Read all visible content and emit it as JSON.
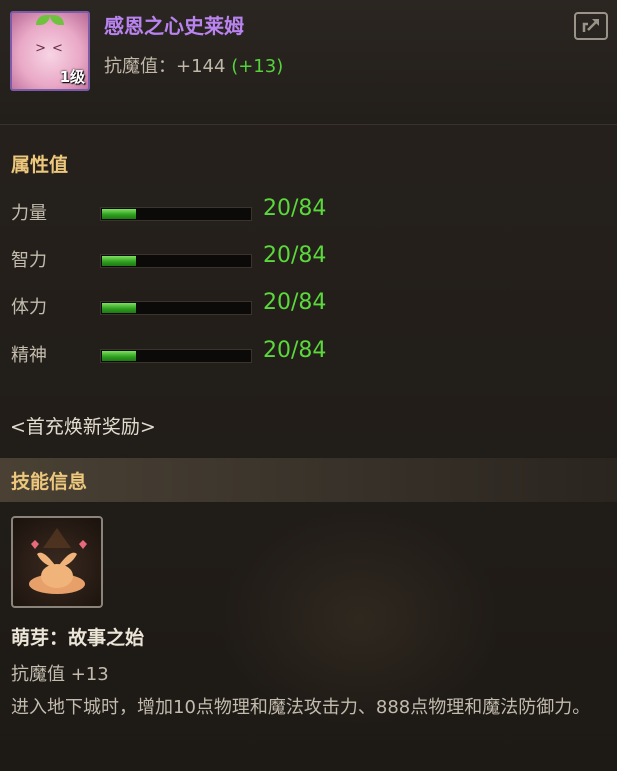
{
  "item": {
    "name": "感恩之心史莱姆",
    "level": "1级",
    "stat_label": "抗魔值：",
    "stat_value": "+144",
    "stat_bonus": "(+13)"
  },
  "attributes": {
    "title": "属性值",
    "items": [
      {
        "label": "力量",
        "value": "20/84",
        "progress": 0.238
      },
      {
        "label": "智力",
        "value": "20/84",
        "progress": 0.238
      },
      {
        "label": "体力",
        "value": "20/84",
        "progress": 0.238
      },
      {
        "label": "精神",
        "value": "20/84",
        "progress": 0.238
      }
    ]
  },
  "reward_link": "<首充焕新奖励>",
  "skill": {
    "section_title": "技能信息",
    "name": "萌芽：故事之始",
    "stat": "抗魔值 +13",
    "description": "进入地下城时，增加10点物理和魔法攻击力、888点物理和魔法防御力。"
  },
  "colors": {
    "item_name": "#b983f0",
    "section_title": "#ecc77c",
    "attr_value": "#5ad83c",
    "bonus": "#56d23c"
  },
  "icons": {
    "item": "slime-icon",
    "share": "share-icon",
    "skill": "sprout-icon"
  }
}
